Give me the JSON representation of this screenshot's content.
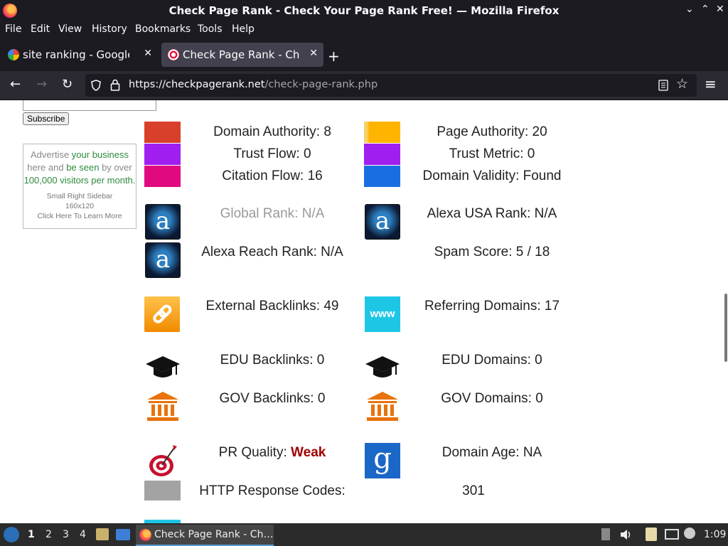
{
  "window": {
    "title": "Check Page Rank - Check Your Page Rank Free! — Mozilla Firefox",
    "min": "⌄",
    "max": "⌃",
    "close": "✕"
  },
  "menu": [
    "File",
    "Edit",
    "View",
    "History",
    "Bookmarks",
    "Tools",
    "Help"
  ],
  "tabs": [
    {
      "label": "site ranking - Google Sea",
      "close": "✕"
    },
    {
      "label": "Check Page Rank - Check",
      "close": "✕"
    }
  ],
  "new_tab": "+",
  "nav": {
    "back": "←",
    "forward": "→",
    "reload": "↻",
    "url_host": "https://checkpagerank.net",
    "url_path": "/check-page-rank.php",
    "menu": "≡",
    "bookmark": "☆"
  },
  "sidebar": {
    "subscribe_label": "Subscribe",
    "ad": {
      "line1_a": "Advertise ",
      "line1_b": "your business",
      "line2_a": "here and ",
      "line2_b": "be seen",
      "line2_c": " by over",
      "line3": "100,000 visitors per month.",
      "line4": "Small Right Sidebar",
      "line5": "160x120",
      "line6": "Click Here To Learn More"
    }
  },
  "metrics": {
    "domain_authority": "Domain Authority: 8",
    "page_authority": "Page Authority: 20",
    "trust_flow": "Trust Flow: 0",
    "trust_metric": "Trust Metric: 0",
    "citation_flow": "Citation Flow: 16",
    "domain_validity": "Domain Validity: Found",
    "global_rank": "Global Rank: N/A",
    "alexa_usa_rank": "Alexa USA Rank: N/A",
    "alexa_reach_rank": "Alexa Reach Rank: N/A",
    "spam_score": "Spam Score: 5 / 18",
    "external_backlinks": "External Backlinks: 49",
    "referring_domains": "Referring Domains: 17",
    "edu_backlinks": "EDU Backlinks: 0",
    "edu_domains": "EDU Domains: 0",
    "gov_backlinks": "GOV Backlinks: 0",
    "gov_domains": "GOV Domains: 0",
    "pr_quality_label": "PR Quality: ",
    "pr_quality_value": "Weak",
    "domain_age": "Domain Age: NA",
    "http_response_label": "HTTP Response Codes:",
    "http_response_value": "301",
    "www_icon_text": "www",
    "alexa_letter": "a",
    "google_letter": "g"
  },
  "colors": {
    "domain_authority": "#d9402b",
    "page_authority": "#ffb400",
    "trust_flow": "#a01ff0",
    "trust_metric": "#a01ff0",
    "citation_flow": "#e0097f",
    "domain_validity": "#1a6fe0",
    "http": "#a3a3a3",
    "weak": "#a00000"
  },
  "taskbar": {
    "workspaces": [
      "1",
      "2",
      "3",
      "4"
    ],
    "task_label": "Check Page Rank - Ch…",
    "clock": "1:09"
  }
}
